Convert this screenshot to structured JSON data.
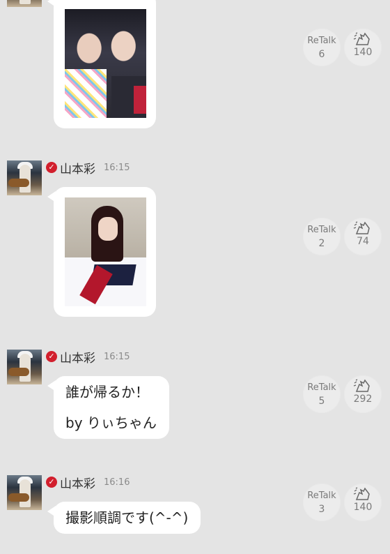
{
  "messages": [
    {
      "type": "photo",
      "retalk_label": "ReTalk",
      "retalk_count": "6",
      "clap_count": "140"
    },
    {
      "type": "photo",
      "author": "山本彩",
      "time": "16:15",
      "retalk_label": "ReTalk",
      "retalk_count": "2",
      "clap_count": "74"
    },
    {
      "type": "text",
      "author": "山本彩",
      "time": "16:15",
      "lines": [
        "誰が帰るか！",
        "by りぃちゃん"
      ],
      "retalk_label": "ReTalk",
      "retalk_count": "5",
      "clap_count": "292"
    },
    {
      "type": "text",
      "author": "山本彩",
      "time": "16:16",
      "lines": [
        "撮影順調です(^-^)"
      ],
      "retalk_label": "ReTalk",
      "retalk_count": "3",
      "clap_count": "140"
    }
  ],
  "icons": {
    "verified": "check-badge-icon",
    "clap": "clapping-hands-icon"
  },
  "colors": {
    "verified_red": "#d21f2d",
    "background": "#e4e4e4"
  }
}
